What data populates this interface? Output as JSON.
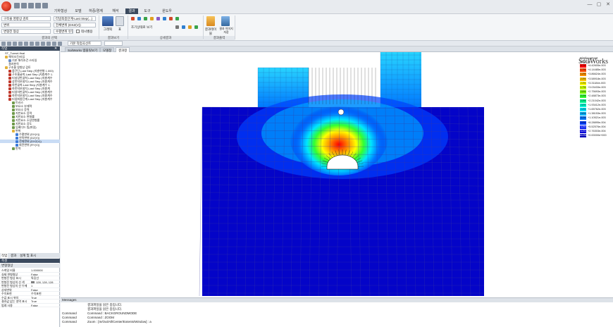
{
  "app": {
    "menu_tabs": [
      "기하형상",
      "모델",
      "하중/경계조건",
      "해석",
      "결과",
      "도구",
      "윈도우"
    ],
    "active_tab": "결과",
    "window_buttons": [
      "—",
      "▢",
      "✕"
    ],
    "colors": {
      "menu_active": "#3b4a5e",
      "ribbon_bg": "#f4f6f8",
      "panel_header": "#3b4a5e"
    }
  },
  "ribbon": {
    "combo_case": "구조물 영향상 검토",
    "combo_step": "터널최종단계-Last Step(...)",
    "combo_result": "변위",
    "combo_component": "전체변위 (DXZ(V))",
    "combo_shape": "변형전 형상",
    "combo_contour": "수평변위 유형",
    "checkbox_label": "데시벨용",
    "group_result_select": "결과의 선택",
    "group_view": "결과보기",
    "group_detail": "상세결과",
    "group_table": "결과출력",
    "btn_contour": "그래픽",
    "btn_table": "표",
    "btn_reset": "조기상태로 보기",
    "btn_report": "결과테이블",
    "btn_image": "결과 이미지저장"
  },
  "toolbar": {
    "combo_view": "기본 작업곡선트"
  },
  "left_panel": {
    "header": "작업",
    "tree": [
      {
        "label": "ST_Tunnel-final",
        "level": 0,
        "icon": "none"
      },
      {
        "label": "해석조건/타입",
        "level": 1,
        "icon": "folder-icon"
      },
      {
        "label": "기본 해석조건 스타일",
        "level": 2,
        "icon": "doc-icon"
      },
      {
        "label": "결과분석",
        "level": 1,
        "icon": "none"
      },
      {
        "label": "구조물 영향상 검토",
        "level": 1,
        "icon": "folder-icon"
      },
      {
        "label": "중간단-Last Step (지층변형 1.000)",
        "level": 2,
        "icon": "step-icon"
      },
      {
        "label": "구조물굴착-Last Step (지층계수 1.",
        "level": 2,
        "icon": "step-icon"
      },
      {
        "label": "터널상반굴착-Last Step (지층계수",
        "level": 2,
        "icon": "step-icon"
      },
      {
        "label": "상반지보설치-Last Step (지층계수",
        "level": 2,
        "icon": "step-icon"
      },
      {
        "label": "하반굴착-Last Step (지층계수 1.",
        "level": 2,
        "icon": "step-icon"
      },
      {
        "label": "하반지보설치-Last Step (지층계",
        "level": 2,
        "icon": "step-icon"
      },
      {
        "label": "터널하반굴착-Last Step (지층계수",
        "level": 2,
        "icon": "step-icon"
      },
      {
        "label": "하반지보설치-Last Step (지층계수",
        "level": 2,
        "icon": "step-icon"
      },
      {
        "label": "터널최종단계-Last Step (지층계수",
        "level": 2,
        "icon": "step-icon"
      },
      {
        "label": "트러스",
        "level": 3,
        "icon": "node-icon"
      },
      {
        "label": "보요소 부재력",
        "level": 3,
        "icon": "node-icon"
      },
      {
        "label": "보요소 응력",
        "level": 3,
        "icon": "node-icon"
      },
      {
        "label": "지반요소 응력",
        "level": 3,
        "icon": "node-icon"
      },
      {
        "label": "지반요소 변형률",
        "level": 3,
        "icon": "node-icon"
      },
      {
        "label": "지반요소 소성변형률",
        "level": 3,
        "icon": "node-icon"
      },
      {
        "label": "지반요소 강도",
        "level": 3,
        "icon": "node-icon"
      },
      {
        "label": "임베디드 빔(파일)",
        "level": 3,
        "icon": "node-icon"
      },
      {
        "label": "변위",
        "level": 3,
        "icon": "folder-icon"
      },
      {
        "label": "수평변위 (DX(V))",
        "level": 4,
        "icon": "leaf-icon"
      },
      {
        "label": "연직변위 (DZ(V))",
        "level": 4,
        "icon": "leaf-icon"
      },
      {
        "label": "전체변위 (DXZ(V))",
        "level": 4,
        "icon": "leaf-icon",
        "selected": true
      },
      {
        "label": "회전변위 (RY(V))",
        "level": 4,
        "icon": "leaf-icon"
      },
      {
        "label": "반력",
        "level": 3,
        "icon": "node-icon"
      }
    ],
    "mid_tabs": [
      "작업",
      "결과",
      "설계 및 표시"
    ],
    "prop_header": "속성",
    "prop_section": "변형형상",
    "props": [
      {
        "k": "스케일 비율",
        "v": "1.000000"
      },
      {
        "k": "실제 변형형상",
        "v": "False"
      },
      {
        "k": "변형전 형상 표시",
        "v": "특징선"
      },
      {
        "k": "변형전 형상의 선 색",
        "v": "128, 128, 128"
      },
      {
        "k": "변형전 형상의 선 두께",
        "v": "1"
      },
      {
        "k": "상대변위",
        "v": "False"
      },
      {
        "k": "수치표현",
        "v": "수치표현"
      },
      {
        "k": "수값 표시 위치",
        "v": "True"
      },
      {
        "k": "결과값 없는 영역 표시",
        "v": "True"
      },
      {
        "k": "범례 사용",
        "v": "False"
      }
    ]
  },
  "doc_tabs": [
    "SoilWorks 템플릿보기",
    "모델창",
    "결과창"
  ],
  "viewport": {
    "brand": "SoilWorks",
    "legend_title": "Displacement",
    "legend_sub": "DXZ , m",
    "legend": [
      {
        "pct": "0.7%",
        "v": "+4.42605e-003",
        "color": "#ff0000"
      },
      {
        "pct": "1.7%",
        "v": "+4.14485e-003",
        "color": "#ff4a00"
      },
      {
        "pct": "1.2%",
        "v": "+3.86624e-003",
        "color": "#ff9400"
      },
      {
        "pct": "2.3%",
        "v": "+3.58918e-003",
        "color": "#ffc800"
      },
      {
        "pct": "2.3%",
        "v": "+3.31184e-003",
        "color": "#ffff00"
      },
      {
        "pct": "1.7%",
        "v": "+3.03433e-003",
        "color": "#c8ff00"
      },
      {
        "pct": "2.5%",
        "v": "+2.75693e-003",
        "color": "#7cff00"
      },
      {
        "pct": "2.1%",
        "v": "+2.48873e-003",
        "color": "#32ff32"
      },
      {
        "pct": "2.3%",
        "v": "+2.21042e-003",
        "color": "#00ff96"
      },
      {
        "pct": "2.6%",
        "v": "+1.93412e-003",
        "color": "#00ffd7"
      },
      {
        "pct": "2.4%",
        "v": "+1.65762e-003",
        "color": "#00e6ff"
      },
      {
        "pct": "2.6%",
        "v": "+1.38153e-003",
        "color": "#00b4ff"
      },
      {
        "pct": "3.1%",
        "v": "+1.10521e-003",
        "color": "#0078ff"
      },
      {
        "pct": "2.9%",
        "v": "+8.28895e-004",
        "color": "#0040ff"
      },
      {
        "pct": "3.3%",
        "v": "+5.52576e-004",
        "color": "#0018f0"
      },
      {
        "pct": "5.4%",
        "v": "+2.76303e-004",
        "color": "#0000d8"
      },
      {
        "pct": "63.9%",
        "v": "+0.00000e+000",
        "color": "#0000b8"
      }
    ],
    "colors": {
      "ground": "#0404c8",
      "mesh": "#3a3aa0",
      "sky": "#ffffff"
    }
  },
  "messages": {
    "header": "Messages",
    "lines": [
      {
        "k": "",
        "v": "결과파일을 읽은 중입니다."
      },
      {
        "k": "",
        "v": "결과파일을 읽은 중입니다."
      },
      {
        "k": "Command",
        "v": "Command : BACKGROUNDMODE"
      },
      {
        "k": "Command",
        "v": "Command : ZOOM"
      },
      {
        "k": "Command",
        "v": "Zoom : [In/Out/All/Center/Extents/Window] : a"
      }
    ]
  }
}
